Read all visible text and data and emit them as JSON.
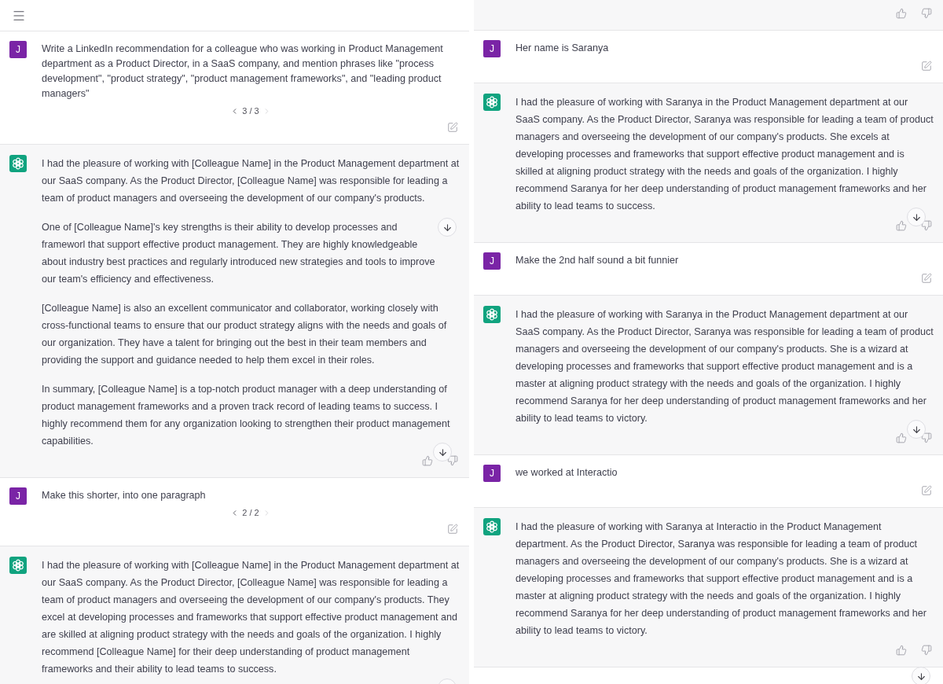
{
  "panels": [
    {
      "top_bar": true,
      "scroll_button_bottom": true,
      "messages": [
        {
          "kind": "user",
          "avatar": "J",
          "text": "Write a LinkedIn recommendation for a colleague who was working in Product Management department as a Product Director, in a SaaS company, and mention phrases like \"process development\", \"product strategy\", \"product management frameworks\", and \"leading product managers\"",
          "pager": {
            "label": "3 / 3",
            "prev_disabled": false,
            "next_disabled": true
          }
        },
        {
          "kind": "assistant",
          "feedback_buttons": true,
          "footer_scroll_button": true,
          "paragraphs": [
            {
              "text": "I had the pleasure of working with [Colleague Name] in the Product Management department at our SaaS company. As the Product Director, [Colleague Name] was responsible for leading a team of product managers and overseeing the development of our company's products."
            },
            {
              "text": "One of [Colleague Name]'s key strengths is their ability to develop processes and frameworl that support effective product management. They are highly knowledgeable about industry best practices and regularly introduced new strategies and tools to improve our team's efficiency and effectiveness.",
              "scroll_button": true
            },
            {
              "text": "[Colleague Name] is also an excellent communicator and collaborator, working closely with cross-functional teams to ensure that our product strategy aligns with the needs and goals of our organization. They have a talent for bringing out the best in their team members and providing the support and guidance needed to help them excel in their roles."
            },
            {
              "text": "In summary, [Colleague Name] is a top-notch product manager with a deep understanding of product management frameworks and a proven track record of leading teams to success. I highly recommend them for any organization looking to strengthen their product management capabilities."
            }
          ]
        },
        {
          "kind": "user",
          "avatar": "J",
          "text": "Make this shorter, into one paragraph",
          "pager": {
            "label": "2 / 2",
            "prev_disabled": false,
            "next_disabled": true
          }
        },
        {
          "kind": "assistant",
          "paragraphs": [
            {
              "text": "I had the pleasure of working with [Colleague Name] in the Product Management department at our SaaS company. As the Product Director, [Colleague Name] was responsible for leading a team of product managers and overseeing the development of our company's products. They excel at developing processes and frameworks that support effective product management and are skilled at aligning product strategy with the needs and goals of the organization. I highly recommend [Colleague Name] for their deep understanding of product management frameworks and their ability to lead teams to success."
            }
          ]
        }
      ]
    },
    {
      "scroll_button_bottom": true,
      "messages": [
        {
          "kind": "assistant",
          "feedback_buttons": true
        },
        {
          "kind": "user",
          "avatar": "J",
          "text": "Her name is Saranya"
        },
        {
          "kind": "assistant",
          "feedback_buttons": true,
          "footer_scroll_button": true,
          "paragraphs": [
            {
              "text": "I had the pleasure of working with Saranya in the Product Management department at our SaaS company. As the Product Director, Saranya was responsible for leading a team of product managers and overseeing the development of our company's products. She excels at developing processes and frameworks that support effective product management and is skilled at aligning product strategy with the needs and goals of the organization. I highly recommend Saranya for her deep understanding of product management frameworks and her ability to lead teams to success."
            }
          ]
        },
        {
          "kind": "user",
          "avatar": "J",
          "text": "Make the 2nd half sound a bit funnier"
        },
        {
          "kind": "assistant",
          "feedback_buttons": true,
          "footer_scroll_button": true,
          "paragraphs": [
            {
              "text": "I had the pleasure of working with Saranya in the Product Management department at our SaaS company. As the Product Director, Saranya was responsible for leading a team of product managers and overseeing the development of our company's products. She is a wizard at developing processes and frameworks that support effective product management and is a master at aligning product strategy with the needs and goals of the organization. I highly recommend Saranya for her deep understanding of product management frameworks and her ability to lead teams to victory."
            }
          ]
        },
        {
          "kind": "user",
          "avatar": "J",
          "text": "we worked at Interactio"
        },
        {
          "kind": "assistant",
          "feedback_buttons": true,
          "paragraphs": [
            {
              "text": "I had the pleasure of working with Saranya at Interactio in the Product Management department. As the Product Director, Saranya was responsible for leading a team of product managers and overseeing the development of our company's products. She is a wizard at developing processes and frameworks that support effective product management and is a master at aligning product strategy with the needs and goals of the organization. I highly recommend Saranya for her deep understanding of product management frameworks and her ability to lead teams to victory."
            }
          ]
        }
      ]
    }
  ]
}
